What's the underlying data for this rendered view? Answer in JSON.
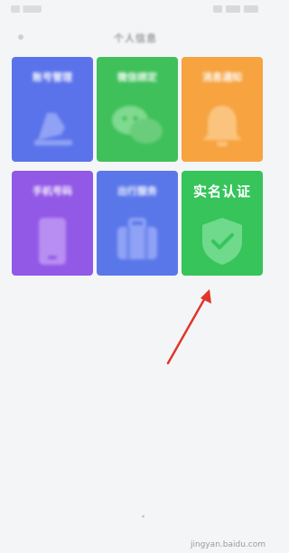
{
  "header": {
    "title": "个人信息"
  },
  "tiles": [
    {
      "label": "账号管理",
      "icon": "pencil-icon",
      "color": "#5b73ea"
    },
    {
      "label": "微信绑定",
      "icon": "wechat-icon",
      "color": "#3fc05a"
    },
    {
      "label": "消息通知",
      "icon": "bell-icon",
      "color": "#f6a340"
    },
    {
      "label": "手机号码",
      "icon": "phone-icon",
      "color": "#9258e6"
    },
    {
      "label": "出行服务",
      "icon": "briefcase-icon",
      "color": "#5a77ea"
    },
    {
      "label": "实名认证",
      "icon": "shield-check-icon",
      "color": "#36c45b"
    }
  ],
  "annotation": {
    "arrow_color": "#e1352a"
  },
  "watermark": "jingyan.baidu.com"
}
